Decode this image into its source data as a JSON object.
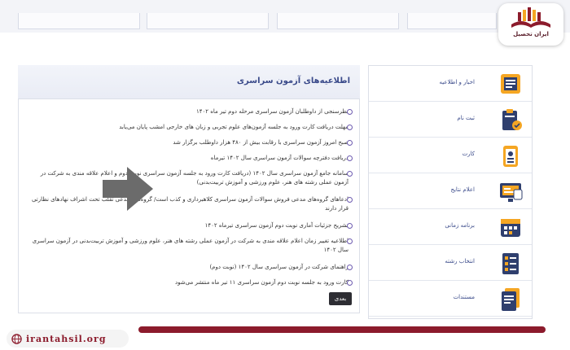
{
  "logo": {
    "text": "ایران تحصیل"
  },
  "site_url": "irantahsil.org",
  "announcements": {
    "title": "اطلاعیه‌های آزمون سراسری",
    "items": [
      "نظرسنجی از داوطلبان آزمون سراسری مرحله دوم تیر ماه ۱۴۰۲",
      "مهلت دریافت کارت ورود به جلسه آزمون‌های علوم تجربی و زبان های خارجی امشب پایان می‌یابد",
      "صبح امروز آزمون سراسری با رقابت بیش از ۴۸۰ هزار داوطلب برگزار شد",
      "دریافت دفترچه سوالات آزمون سراسری سال ۱۴۰۲ تیرماه",
      "سامانه جامع آزمون سراسری سال ۱۴۰۲ (دریافت کارت ورود به جلسه آزمون سراسری نوبت دوم و اعلام علاقه مندی به شرکت در آزمون عملی رشته های هنر، علوم ورزشی و آموزش تربیت‌بدنی)",
      "ادعاهای گروه‌های مدعی فروش سوالات آزمون سراسری کلاهبرداری و کذب است/ گروه‌های مدعی تقلب تحت اشراف نهادهای نظارتی قرار دارند",
      "تشریح جزئیات آماری نوبت دوم آزمون سراسری تیرماه ۱۴۰۲",
      "اطلاعیه تغییر زمان اعلام علاقه مندی به شرکت در آزمون عملی رشته های هنر، علوم ورزشی و آموزش تربیت‌بدنی در آزمون سراسری سال ۱۴۰۲",
      "راهنمای شرکت در آزمون سراسری سال ۱۴۰۲ (نوبت دوم)",
      "کارت ورود به جلسه نوبت دوم آزمون سراسری ۱۱ تیر ماه منتشر می‌شود"
    ],
    "next_label": "بعدی"
  },
  "menu": {
    "items": [
      {
        "label": "اخبار و اطلاعیه",
        "icon": "newspaper-icon"
      },
      {
        "label": "ثبت نام",
        "icon": "clipboard-edit-icon"
      },
      {
        "label": "کارت",
        "icon": "id-card-icon"
      },
      {
        "label": "اعلام نتایج",
        "icon": "monitor-results-icon"
      },
      {
        "label": "برنامه زمانی",
        "icon": "calendar-icon"
      },
      {
        "label": "انتخاب رشته",
        "icon": "list-select-icon"
      },
      {
        "label": "مستندات",
        "icon": "documents-icon"
      }
    ]
  },
  "colors": {
    "accent_purple": "#6d5bb0",
    "title_blue": "#3a4a8a",
    "brand_maroon": "#8c1b2c",
    "icon_orange": "#f5a623",
    "icon_navy": "#2f3f6e"
  }
}
